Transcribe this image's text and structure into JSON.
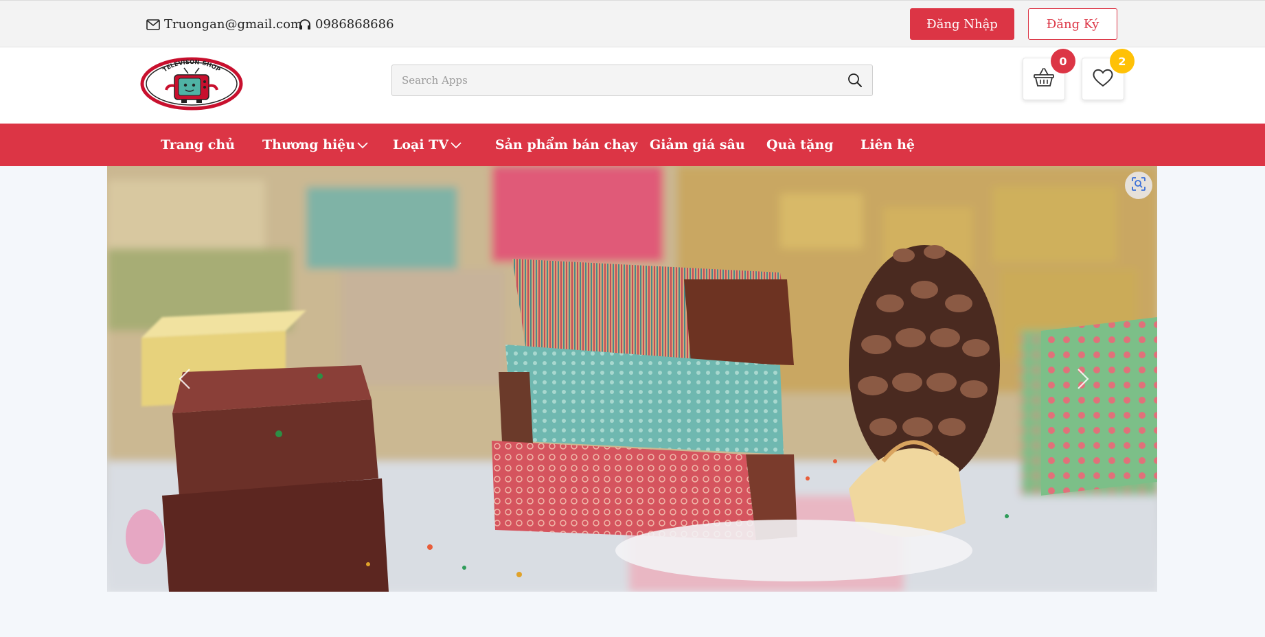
{
  "topbar": {
    "email": "Truongan@gmail.com",
    "phone": "0986868686",
    "login_label": "Đăng Nhập",
    "register_label": "Đăng Ký"
  },
  "header": {
    "logo_text": "TELEVISON-SHOP",
    "search_placeholder": "Search Apps",
    "cart_count": "0",
    "wishlist_count": "2"
  },
  "nav": {
    "items": [
      {
        "label": "Trang chủ"
      },
      {
        "label": "Thương hiệu"
      },
      {
        "label": "Loại TV"
      },
      {
        "label": "Sản phẩm bán chạy"
      },
      {
        "label": "Giảm giá sâu"
      },
      {
        "label": "Quà tặng"
      },
      {
        "label": "Liên hệ"
      }
    ]
  },
  "colors": {
    "brand_red": "#dc3545",
    "badge_yellow": "#ffc107",
    "topbar_bg": "#f3f3f3",
    "page_bg": "#f4f7fb"
  },
  "icons": {
    "email": "envelope-icon",
    "phone": "headphones-icon",
    "search": "search-icon",
    "cart": "basket-icon",
    "wishlist": "heart-icon",
    "prev": "chevron-left-icon",
    "next": "chevron-right-icon",
    "lens": "visual-search-icon"
  }
}
